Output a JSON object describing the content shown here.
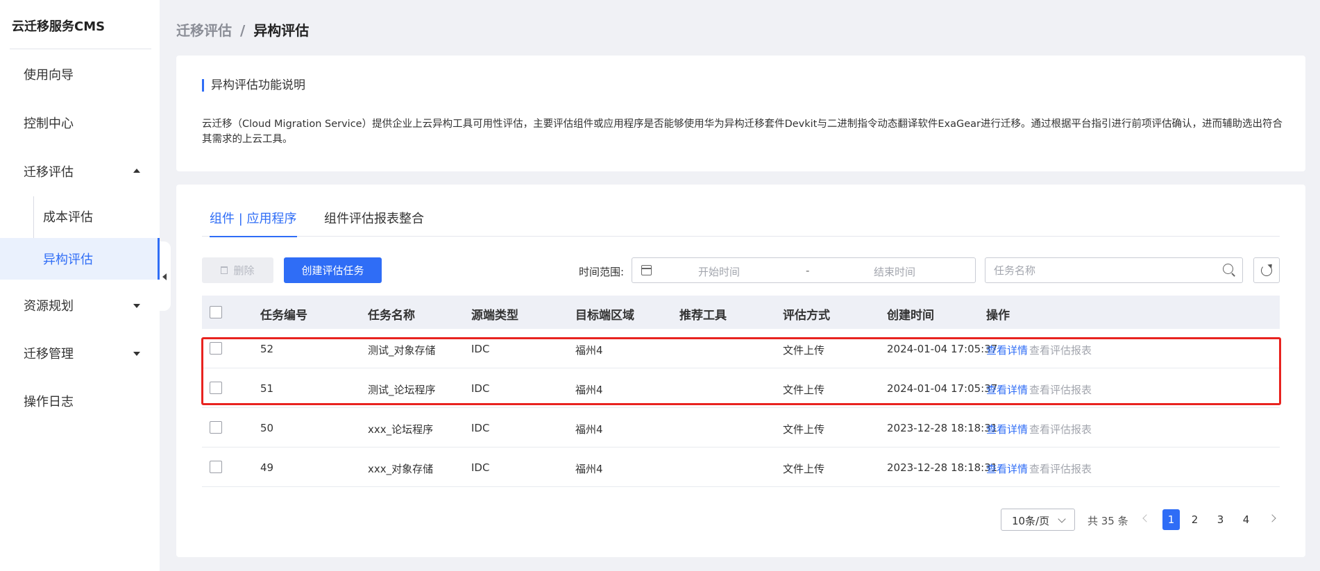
{
  "app": {
    "title": "云迁移服务CMS"
  },
  "sidebar": {
    "items": [
      {
        "label": "使用向导"
      },
      {
        "label": "控制中心"
      },
      {
        "label": "迁移评估"
      },
      {
        "label": "资源规划"
      },
      {
        "label": "迁移管理"
      },
      {
        "label": "操作日志"
      }
    ],
    "sub_items": [
      {
        "label": "成本评估"
      },
      {
        "label": "异构评估"
      }
    ]
  },
  "breadcrumb": {
    "parent": "迁移评估",
    "separator": "/",
    "current": "异构评估"
  },
  "intro": {
    "title": "异构评估功能说明",
    "text": "云迁移（Cloud Migration Service）提供企业上云异构工具可用性评估，主要评估组件或应用程序是否能够使用华为异构迁移套件Devkit与二进制指令动态翻译软件ExaGear进行迁移。通过根据平台指引进行前项评估确认，进而辅助选出符合其需求的上云工具。"
  },
  "tabs": [
    {
      "label": "组件 | 应用程序"
    },
    {
      "label": "组件评估报表整合"
    }
  ],
  "toolbar": {
    "delete_label": "删除",
    "create_label": "创建评估任务",
    "time_range_label": "时间范围:",
    "start_placeholder": "开始时间",
    "range_separator": "-",
    "end_placeholder": "结束时间",
    "search_placeholder": "任务名称"
  },
  "table": {
    "columns": [
      "任务编号",
      "任务名称",
      "源端类型",
      "目标端区域",
      "推荐工具",
      "评估方式",
      "创建时间",
      "操作"
    ],
    "rows": [
      {
        "id": "52",
        "name": "测试_对象存储",
        "source": "IDC",
        "region": "福州4",
        "tool": "",
        "method": "文件上传",
        "created": "2024-01-04 17:05:37",
        "detail": "查看详情",
        "report": "查看评估报表"
      },
      {
        "id": "51",
        "name": "测试_论坛程序",
        "source": "IDC",
        "region": "福州4",
        "tool": "",
        "method": "文件上传",
        "created": "2024-01-04 17:05:37",
        "detail": "查看详情",
        "report": "查看评估报表"
      },
      {
        "id": "50",
        "name": "xxx_论坛程序",
        "source": "IDC",
        "region": "福州4",
        "tool": "",
        "method": "文件上传",
        "created": "2023-12-28 18:18:31",
        "detail": "查看详情",
        "report": "查看评估报表"
      },
      {
        "id": "49",
        "name": "xxx_对象存储",
        "source": "IDC",
        "region": "福州4",
        "tool": "",
        "method": "文件上传",
        "created": "2023-12-28 18:18:31",
        "detail": "查看详情",
        "report": "查看评估报表"
      }
    ]
  },
  "pagination": {
    "page_size": "10条/页",
    "total": "共 35 条",
    "pages": [
      "1",
      "2",
      "3",
      "4"
    ],
    "current": "1"
  },
  "colors": {
    "accent": "#2f6df6",
    "highlight": "#e8231f"
  }
}
